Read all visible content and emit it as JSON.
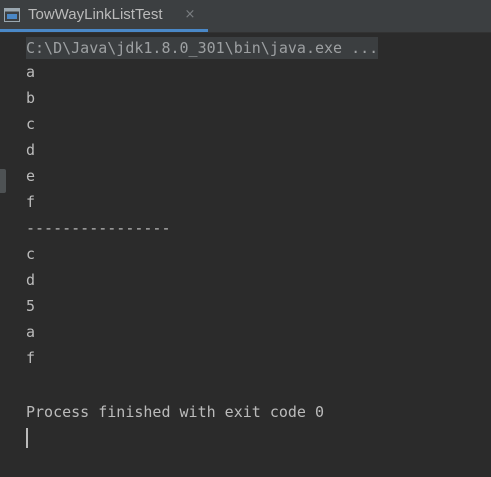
{
  "tab": {
    "title": "TowWayLinkListTest",
    "close": "×",
    "icon": "console-icon"
  },
  "console": {
    "command": "C:\\D\\Java\\jdk1.8.0_301\\bin\\java.exe ...",
    "lines": [
      "a",
      "b",
      "c",
      "d",
      "e",
      "f",
      "----------------",
      "c",
      "d",
      "5",
      "a",
      "f"
    ],
    "exit_message": "Process finished with exit code 0"
  },
  "colors": {
    "background": "#2b2b2b",
    "tab_background": "#3c3f41",
    "accent": "#4a88c7",
    "text": "#bbbbbb"
  }
}
